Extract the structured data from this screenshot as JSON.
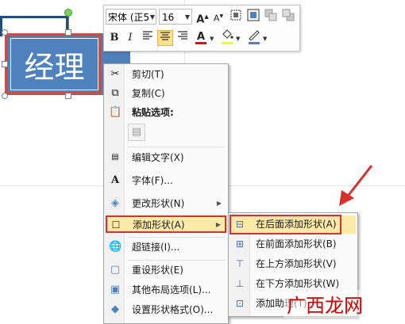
{
  "shape": {
    "text": "经理",
    "fill": "#4f81bd",
    "highlight": "#c0504d"
  },
  "mini_toolbar": {
    "font_name": "宋体 (正5",
    "font_size": "16",
    "grow_font": "A",
    "shrink_font": "A",
    "bold": "B",
    "italic": "I",
    "font_color": "A",
    "font_color_bar": "#ff0000",
    "fill_color_bar": "#ffff00",
    "outline_color_bar": "#4f81bd"
  },
  "context_menu": {
    "items": [
      {
        "label": "剪切(T)",
        "icon": "scissors-icon"
      },
      {
        "label": "复制(C)",
        "icon": "copy-icon"
      },
      {
        "label": "粘贴选项:",
        "icon": "paste-icon"
      },
      {
        "label": "编辑文字(X)",
        "icon": "edit-text-icon"
      },
      {
        "label": "字体(F)...",
        "icon": "font-icon"
      },
      {
        "label": "更改形状(N)",
        "icon": "change-shape-icon"
      },
      {
        "label": "添加形状(A)",
        "icon": "add-shape-icon"
      },
      {
        "label": "超链接(I)...",
        "icon": "hyperlink-icon"
      },
      {
        "label": "重设形状(E)",
        "icon": "reset-shape-icon"
      },
      {
        "label": "其他布局选项(L)...",
        "icon": "layout-icon"
      },
      {
        "label": "设置形状格式(O)...",
        "icon": "format-shape-icon"
      }
    ]
  },
  "submenu": {
    "items": [
      {
        "label": "在后面添加形状(A)"
      },
      {
        "label": "在前面添加形状(B)"
      },
      {
        "label": "在上方添加形状(V)"
      },
      {
        "label": "在下方添加形状(W)"
      },
      {
        "label": "添加助理(T)"
      }
    ]
  },
  "watermark": "广西龙网",
  "colors": {
    "highlight": "#fde9a8",
    "callout": "#d9302c"
  }
}
